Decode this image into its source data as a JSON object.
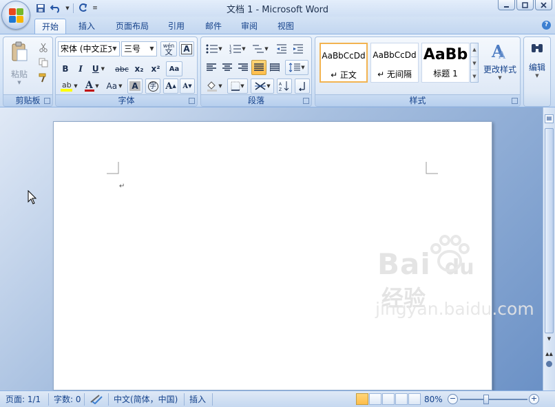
{
  "window": {
    "title": "文档 1 - Microsoft Word"
  },
  "tabs": [
    "开始",
    "插入",
    "页面布局",
    "引用",
    "邮件",
    "审阅",
    "视图"
  ],
  "ribbon": {
    "clipboard": {
      "paste_label": "粘贴",
      "group_label": "剪贴板"
    },
    "font": {
      "font_name": "宋体 (中文正文",
      "font_size": "三号",
      "group_label": "字体",
      "bold": "B",
      "italic": "I",
      "underline": "U",
      "strike": "abc",
      "subscript": "x₂",
      "superscript": "x²",
      "change_case": "Aa",
      "grow": "A",
      "shrink": "A",
      "char_border": "A",
      "enclose": "字",
      "phonetic": "wén 文",
      "clear": "A"
    },
    "paragraph": {
      "group_label": "段落"
    },
    "styles": {
      "group_label": "样式",
      "items": [
        {
          "sample": "AaBbCcDd",
          "name": "↵ 正文"
        },
        {
          "sample": "AaBbCcDd",
          "name": "↵ 无间隔"
        },
        {
          "sample": "AaBb",
          "name": "标题 1"
        }
      ],
      "change_styles": "更改样式"
    },
    "editing": {
      "label": "编辑"
    }
  },
  "document": {
    "paragraph_mark": "↵"
  },
  "watermark": {
    "brand": "Bai",
    "brand2": "du",
    "cn": "经验",
    "url": "jingyan.baidu.com"
  },
  "status": {
    "page": "页面: 1/1",
    "words": "字数: 0",
    "language": "中文(简体，中国)",
    "mode": "插入",
    "zoom": "80%"
  },
  "colors": {
    "accent": "#15428b",
    "highlight_yellow": "#ffbd4a",
    "font_red": "#c00000"
  }
}
